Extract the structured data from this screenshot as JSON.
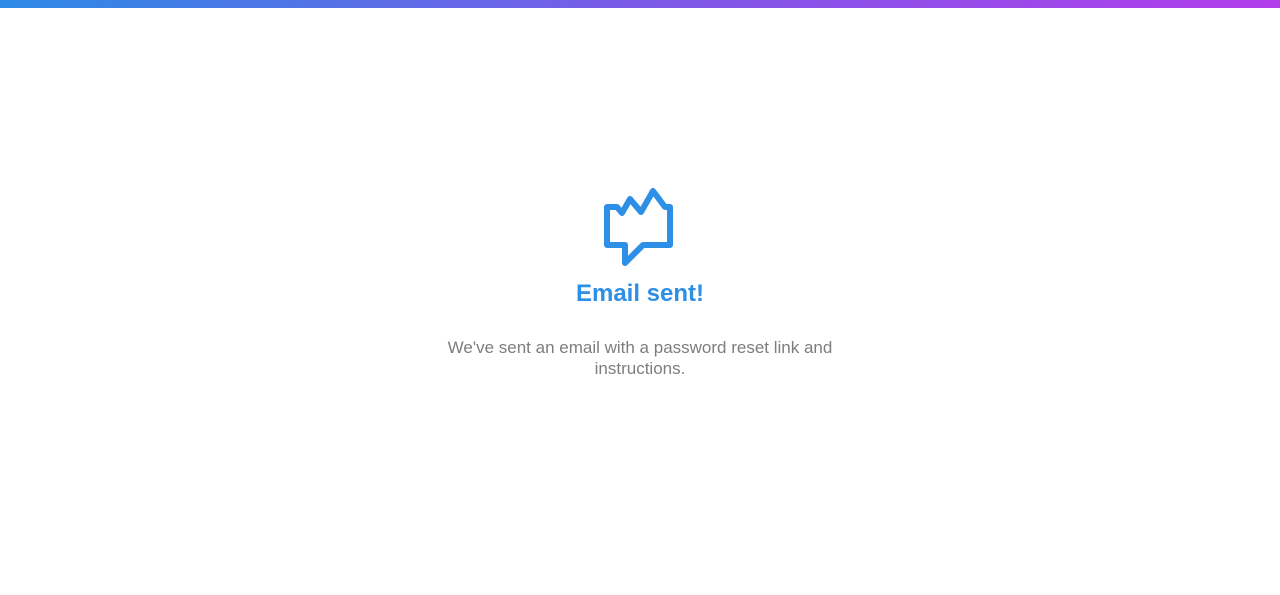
{
  "confirmation": {
    "logo_icon": "chat-bubble-spark-icon",
    "title": "Email sent!",
    "message": "We've sent an email with a password reset link and instructions."
  },
  "colors": {
    "accent": "#2d8fe6",
    "gradient_start": "#2c8ae6",
    "gradient_end": "#b23de9",
    "message_text": "#7d7d7d"
  }
}
